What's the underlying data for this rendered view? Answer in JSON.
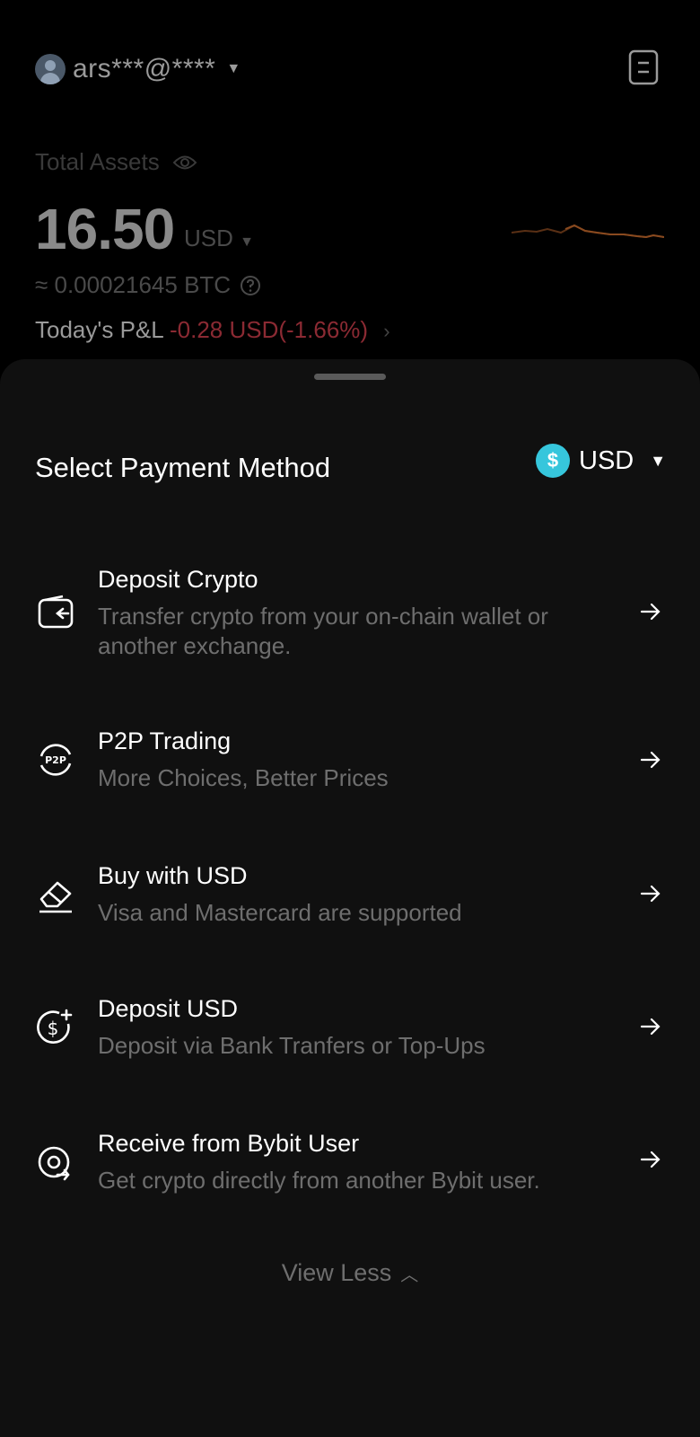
{
  "header": {
    "account": "ars***@****",
    "total_assets_label": "Total Assets",
    "total_amount": "16.50",
    "total_currency": "USD",
    "btc_equivalent": "≈ 0.00021645 BTC",
    "pnl_label": "Today's P&L",
    "pnl_value": "-0.28 USD(-1.66%)",
    "colors": {
      "negative": "#8b2a33",
      "sparkline": "#8a4a1f"
    }
  },
  "sheet": {
    "title": "Select Payment Method",
    "currency": "USD",
    "coin_symbol": "$",
    "items": [
      {
        "title": "Deposit Crypto",
        "subtitle": "Transfer crypto from your on-chain wallet or another exchange.",
        "icon": "wallet-deposit-icon"
      },
      {
        "title": "P2P Trading",
        "subtitle": "More Choices, Better Prices",
        "icon": "p2p-icon"
      },
      {
        "title": "Buy with USD",
        "subtitle": "Visa and Mastercard are supported",
        "icon": "card-icon"
      },
      {
        "title": "Deposit USD",
        "subtitle": "Deposit via Bank Tranfers or Top-Ups",
        "icon": "dollar-plus-icon"
      },
      {
        "title": "Receive from Bybit User",
        "subtitle": "Get crypto directly from another Bybit user.",
        "icon": "user-transfer-icon"
      }
    ],
    "view_less": "View Less"
  }
}
